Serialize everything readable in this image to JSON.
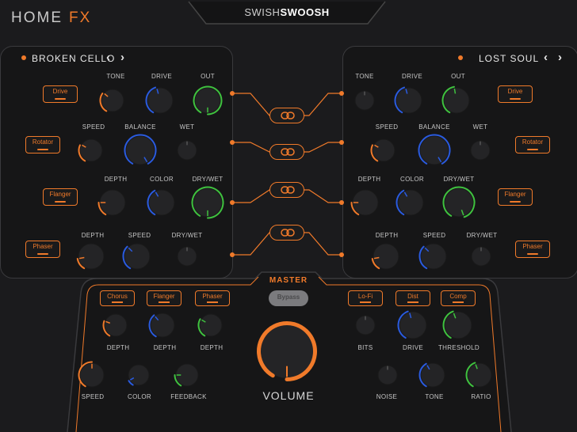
{
  "brand": {
    "home": "HOME",
    "fx": "FX"
  },
  "title": {
    "a": "SWISH",
    "b": "SWOOSH"
  },
  "left": {
    "preset": "BROKEN CELLO",
    "rows": [
      {
        "btn": "Drive",
        "labels": [
          "TONE",
          "DRIVE",
          "OUT"
        ]
      },
      {
        "btn": "Rotator",
        "labels": [
          "SPEED",
          "BALANCE",
          "WET"
        ]
      },
      {
        "btn": "Flanger",
        "labels": [
          "DEPTH",
          "COLOR",
          "DRY/WET"
        ]
      },
      {
        "btn": "Phaser",
        "labels": [
          "DEPTH",
          "SPEED",
          "DRY/WET"
        ]
      }
    ]
  },
  "right": {
    "preset": "LOST SOUL",
    "rows": [
      {
        "btn": "Drive",
        "labels": [
          "TONE",
          "DRIVE",
          "OUT"
        ]
      },
      {
        "btn": "Rotator",
        "labels": [
          "SPEED",
          "BALANCE",
          "WET"
        ]
      },
      {
        "btn": "Flanger",
        "labels": [
          "DEPTH",
          "COLOR",
          "DRY/WET"
        ]
      },
      {
        "btn": "Phaser",
        "labels": [
          "DEPTH",
          "SPEED",
          "DRY/WET"
        ]
      }
    ]
  },
  "master": {
    "title": "MASTER",
    "bypass": "Bypass",
    "volume": "VOLUME",
    "left_buttons": [
      "Chorus",
      "Flanger",
      "Phaser"
    ],
    "right_buttons": [
      "Lo-Fi",
      "Dist",
      "Comp"
    ],
    "left_labels": [
      [
        "DEPTH",
        "DEPTH",
        "DEPTH"
      ],
      [
        "SPEED",
        "COLOR",
        "FEEDBACK"
      ]
    ],
    "right_labels": [
      [
        "BITS",
        "DRIVE",
        "THRESHOLD"
      ],
      [
        "NOISE",
        "TONE",
        "RATIO"
      ]
    ]
  },
  "colors": {
    "orange": "#f07a2a",
    "blue": "#2a5be0",
    "green": "#3fc23f"
  },
  "icons": {
    "chevron_left": "‹",
    "chevron_right": "›",
    "link": "link-icon"
  }
}
